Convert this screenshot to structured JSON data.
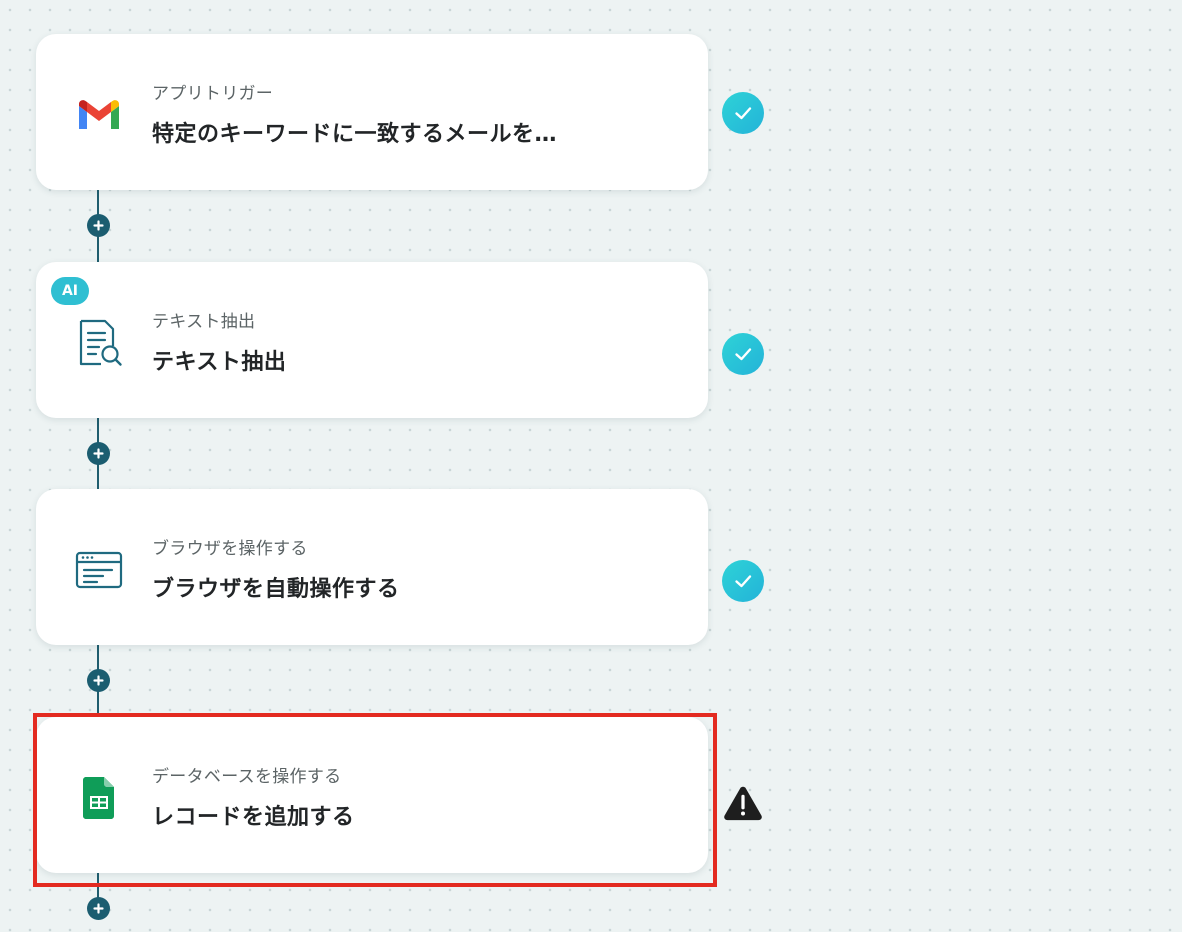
{
  "flow": {
    "steps": [
      {
        "subtitle": "アプリトリガー",
        "title": "特定のキーワードに一致するメールを…",
        "icon": "gmail-icon",
        "status": "completed",
        "ai_badge": ""
      },
      {
        "subtitle": "テキスト抽出",
        "title": "テキスト抽出",
        "icon": "document-search-icon",
        "status": "completed",
        "ai_badge": "AI"
      },
      {
        "subtitle": "ブラウザを操作する",
        "title": "ブラウザを自動操作する",
        "icon": "browser-window-icon",
        "status": "completed",
        "ai_badge": ""
      },
      {
        "subtitle": "データベースを操作する",
        "title": "レコードを追加する",
        "icon": "google-sheets-icon",
        "status": "warning",
        "ai_badge": ""
      }
    ],
    "highlighted_step": 4
  },
  "colors": {
    "background": "#edf3f3",
    "connector": "#1f5d6e",
    "check_status": "#2bc6d8",
    "warning_status": "#1e1e1e",
    "ai_badge": "#2fbfd2",
    "highlight": "#e32a20"
  }
}
